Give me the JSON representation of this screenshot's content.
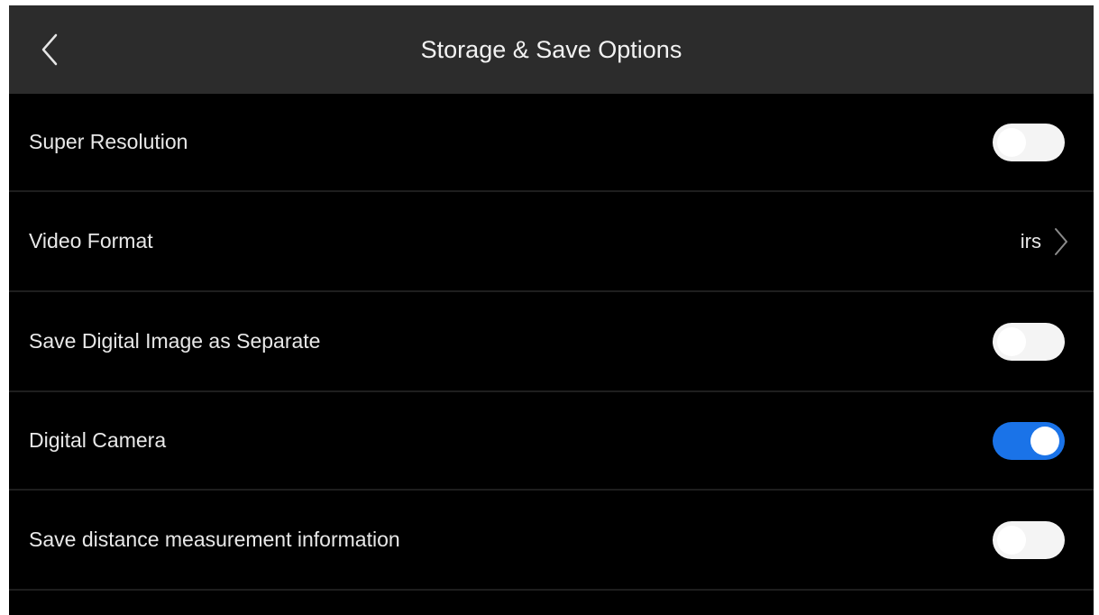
{
  "header": {
    "title": "Storage & Save Options",
    "back_icon": "chevron-left-icon"
  },
  "settings": [
    {
      "label": "Super Resolution",
      "control": "toggle",
      "on": false
    },
    {
      "label": "Video Format",
      "control": "nav",
      "value": "irs",
      "icon": "chevron-right-icon"
    },
    {
      "label": "Save Digital Image as Separate",
      "control": "toggle",
      "on": false
    },
    {
      "label": "Digital Camera",
      "control": "toggle",
      "on": true
    },
    {
      "label": "Save distance measurement information",
      "control": "toggle",
      "on": false
    }
  ],
  "colors": {
    "background": "#000000",
    "header": "#2c2c2c",
    "toggle_on": "#1a73e8",
    "toggle_off": "#f4f4f4",
    "text": "#e8e8e8"
  }
}
